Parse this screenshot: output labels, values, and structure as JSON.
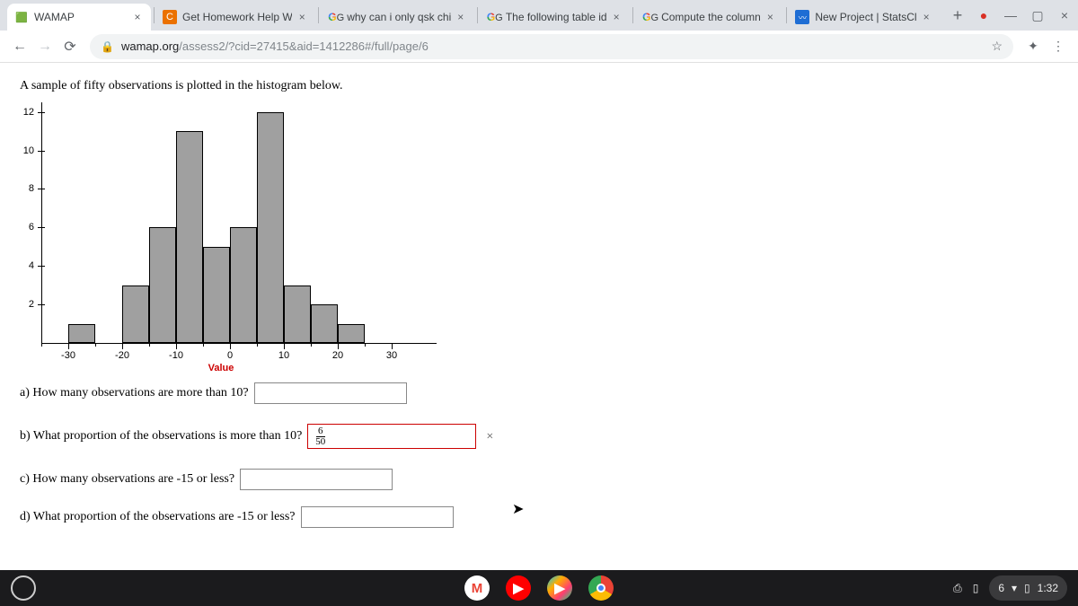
{
  "tabs": [
    {
      "title": "WAMAP",
      "favicon": "wamap"
    },
    {
      "title": "Get Homework Help W",
      "favicon": "chegg"
    },
    {
      "title": "why can i only qsk chi",
      "favicon": "google"
    },
    {
      "title": "The following table id",
      "favicon": "google"
    },
    {
      "title": "Compute the column",
      "favicon": "google"
    },
    {
      "title": "New Project | StatsCl",
      "favicon": "stats"
    }
  ],
  "url": {
    "domain": "wamap.org",
    "path": "/assess2/?cid=27415&aid=1412286#/full/page/6"
  },
  "question_intro": "A sample of fifty observations is plotted in the histogram below.",
  "chart_data": {
    "type": "bar",
    "xlabel": "Value",
    "ylim": [
      0,
      12.5
    ],
    "xlim": [
      -35,
      35
    ],
    "yticks": [
      2,
      4,
      6,
      8,
      10,
      12
    ],
    "xticks": [
      -30,
      -20,
      -10,
      0,
      10,
      20,
      30
    ],
    "bin_edges": [
      -35,
      -30,
      -25,
      -20,
      -15,
      -10,
      -5,
      0,
      5,
      10,
      15,
      20,
      25
    ],
    "values": [
      0,
      1,
      0,
      3,
      6,
      11,
      5,
      6,
      12,
      3,
      2,
      1
    ]
  },
  "parts": {
    "a": "a) How many observations are more than 10?",
    "b": "b) What proportion of the observations is more than 10?",
    "b_value": {
      "num": "6",
      "den": "50"
    },
    "c": "c) How many observations are -15 or less?",
    "d": "d) What proportion of the observations are -15 or less?"
  },
  "tray": {
    "count": "6",
    "time": "1:32"
  }
}
